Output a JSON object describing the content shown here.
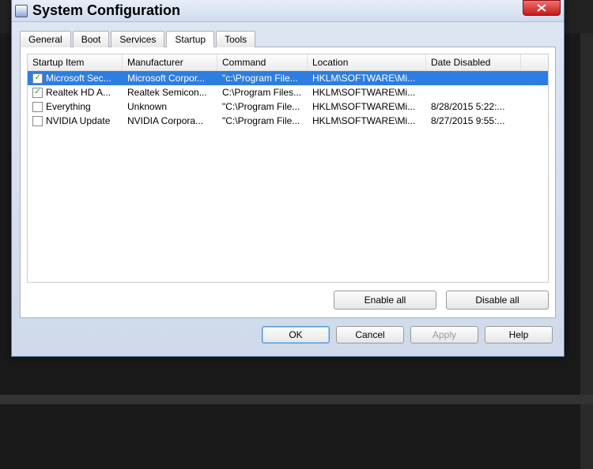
{
  "window": {
    "title": "System Configuration"
  },
  "tabs": {
    "general": "General",
    "boot": "Boot",
    "services": "Services",
    "startup": "Startup",
    "tools": "Tools",
    "active": "startup"
  },
  "columns": {
    "item": "Startup Item",
    "mfr": "Manufacturer",
    "cmd": "Command",
    "loc": "Location",
    "date": "Date Disabled"
  },
  "rows": [
    {
      "checked": true,
      "selected": true,
      "item": "Microsoft Sec...",
      "mfr": "Microsoft Corpor...",
      "cmd": "\"c:\\Program File...",
      "loc": "HKLM\\SOFTWARE\\Mi...",
      "date": ""
    },
    {
      "checked": true,
      "selected": false,
      "item": "Realtek HD A...",
      "mfr": "Realtek Semicon...",
      "cmd": "C:\\Program Files...",
      "loc": "HKLM\\SOFTWARE\\Mi...",
      "date": ""
    },
    {
      "checked": false,
      "selected": false,
      "item": "Everything",
      "mfr": "Unknown",
      "cmd": "\"C:\\Program File...",
      "loc": "HKLM\\SOFTWARE\\Mi...",
      "date": "8/28/2015 5:22:..."
    },
    {
      "checked": false,
      "selected": false,
      "item": "NVIDIA Update",
      "mfr": "NVIDIA Corpora...",
      "cmd": "\"C:\\Program File...",
      "loc": "HKLM\\SOFTWARE\\Mi...",
      "date": "8/27/2015 9:55:..."
    }
  ],
  "panel_buttons": {
    "enable": "Enable all",
    "disable": "Disable all"
  },
  "dialog_buttons": {
    "ok": "OK",
    "cancel": "Cancel",
    "apply": "Apply",
    "help": "Help"
  }
}
